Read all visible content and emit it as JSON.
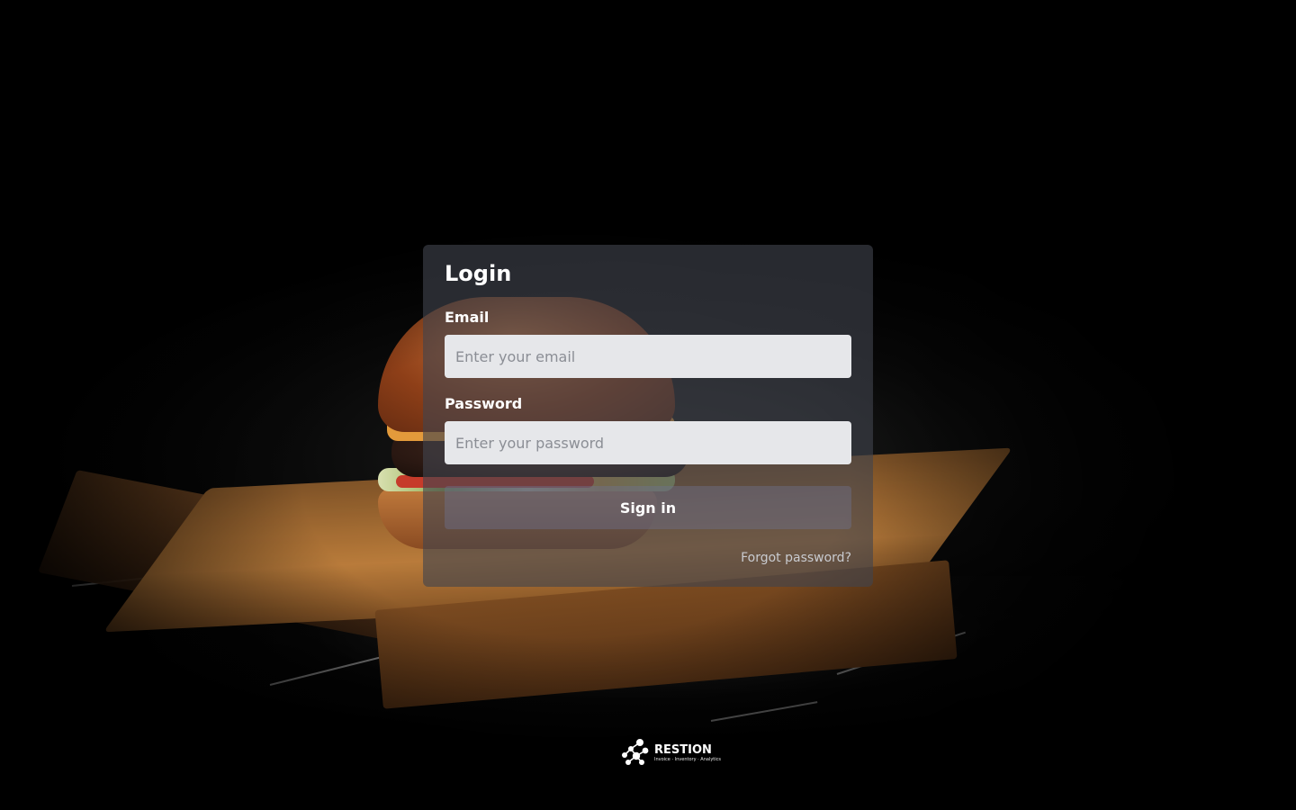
{
  "login": {
    "title": "Login",
    "email_label": "Email",
    "email_placeholder": "Enter your email",
    "password_label": "Password",
    "password_placeholder": "Enter your password",
    "sign_in_label": "Sign in",
    "forgot_label": "Forgot password?"
  },
  "brand": {
    "name": "RESTION",
    "tagline": "Invoice · Inventory · Analytics",
    "logo_icon": "molecule-dots-icon"
  },
  "background": {
    "image": "burger-on-wooden-board-photo"
  },
  "colors": {
    "card_background": "#40444e",
    "input_background": "#e6e7ea",
    "text": "#ffffff",
    "muted_link": "#c9cbd0"
  }
}
